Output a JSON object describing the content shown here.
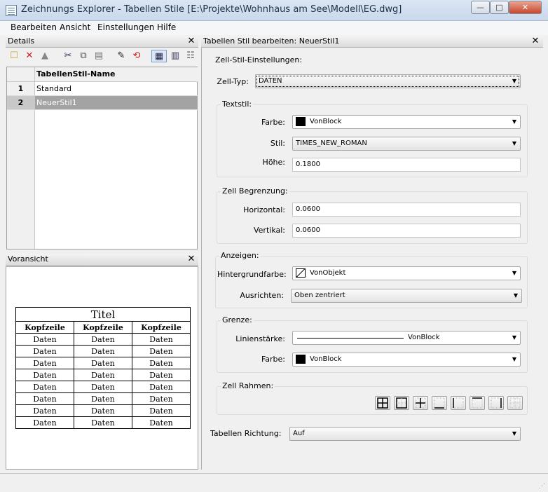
{
  "window": {
    "title": "Zeichnungs Explorer - Tabellen Stile [E:\\Projekte\\Wohnhaus am See\\Modell\\EG.dwg]",
    "min_label": "—",
    "max_label": "□",
    "close_label": "✕"
  },
  "menu": {
    "items": [
      "Bearbeiten",
      "Ansicht",
      "Einstellungen",
      "Hilfe"
    ]
  },
  "details": {
    "title": "Details",
    "close": "✕",
    "toolbar_icons": [
      "new-icon",
      "delete-icon",
      "purge-icon",
      "cut-icon",
      "copy-icon",
      "paste-icon",
      "edit-icon",
      "rename-icon",
      "grid-view-icon",
      "list-view-icon",
      "tree-view-icon"
    ],
    "toolbar_glyphs": [
      "☐",
      "✕",
      "▲",
      "✂",
      "⧉",
      "▤",
      "✎",
      "⟲",
      "▦",
      "▥",
      "☷"
    ],
    "column_header": "TabellenStil-Name",
    "rows": [
      {
        "num": "1",
        "name": "Standard"
      },
      {
        "num": "2",
        "name": "NeuerStil1"
      }
    ]
  },
  "preview": {
    "title": "Voransicht",
    "close": "✕",
    "table_title": "Titel",
    "headers": [
      "Kopfzeile",
      "Kopfzeile",
      "Kopfzeile"
    ],
    "data_cell": "Daten",
    "data_rows": 8
  },
  "editor": {
    "title": "Tabellen Stil bearbeiten: NeuerStil1",
    "close": "✕",
    "zell_stil_label": "Zell-Stil-Einstellungen:",
    "zell_typ_label": "Zell-Typ:",
    "zell_typ_value": "DATEN",
    "textstil": {
      "label": "Textstil:",
      "farbe_label": "Farbe:",
      "farbe_value": "VonBlock",
      "farbe_color": "#000000",
      "stil_label": "Stil:",
      "stil_value": "TIMES_NEW_ROMAN",
      "hoehe_label": "Höhe:",
      "hoehe_value": "0.1800"
    },
    "begrenzung": {
      "label": "Zell Begrenzung:",
      "horizontal_label": "Horizontal:",
      "horizontal_value": "0.0600",
      "vertikal_label": "Vertikal:",
      "vertikal_value": "0.0600"
    },
    "anzeigen": {
      "label": "Anzeigen:",
      "hintergrund_label": "Hintergrundfarbe:",
      "hintergrund_value": "VonObjekt",
      "ausrichten_label": "Ausrichten:",
      "ausrichten_value": "Oben zentriert"
    },
    "grenze": {
      "label": "Grenze:",
      "linienstaerke_label": "Linienstärke:",
      "linienstaerke_value": "VonBlock",
      "farbe_label": "Farbe:",
      "farbe_value": "VonBlock",
      "farbe_color": "#000000"
    },
    "zell_rahmen": {
      "label": "Zell Rahmen:",
      "buttons": [
        "all-borders-icon",
        "outside-border-icon",
        "inside-border-icon",
        "bottom-border-icon",
        "left-border-icon",
        "top-border-icon",
        "right-border-icon",
        "no-border-icon"
      ]
    },
    "richtung_label": "Tabellen Richtung:",
    "richtung_value": "Auf"
  }
}
